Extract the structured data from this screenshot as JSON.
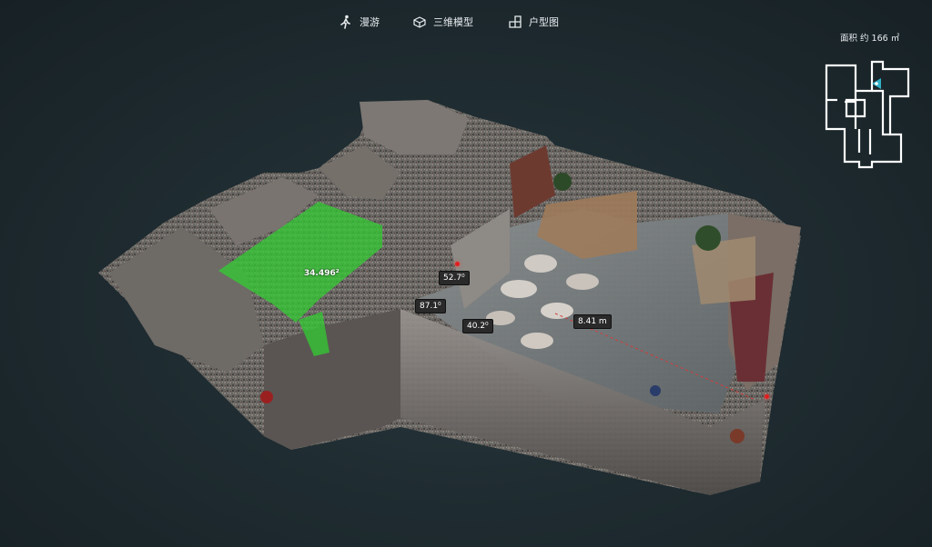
{
  "nav": {
    "walk": {
      "label": "漫游",
      "icon": "walking-person-icon"
    },
    "model3d": {
      "label": "三维模型",
      "icon": "3d-box-icon"
    },
    "floorplan": {
      "label": "户型图",
      "icon": "floorplan-icon"
    }
  },
  "area": {
    "label": "面积 约 166 ㎡"
  },
  "measurements": {
    "area_green": "34.496²",
    "m1": "52.7⁰",
    "m2": "87.1⁰",
    "m3": "40.2⁰",
    "dist": "8.41 m"
  },
  "colors": {
    "background": "#1f2c31",
    "highlight_area": "#33cc33",
    "pin": "#e02020",
    "minimap_marker": "#35c8e0"
  }
}
